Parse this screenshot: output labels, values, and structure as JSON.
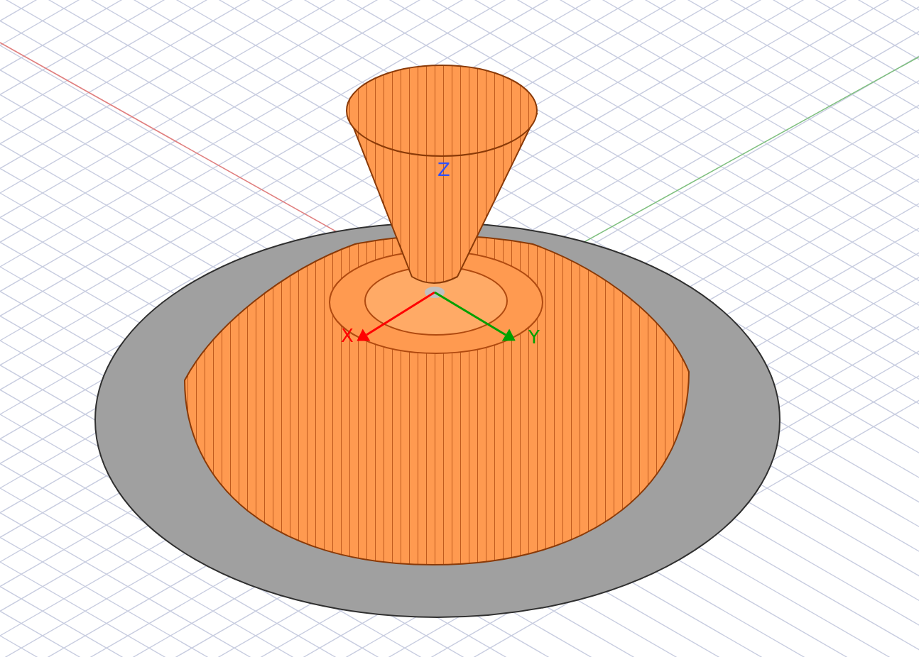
{
  "viewport": {
    "axes": [
      {
        "label": "X",
        "color": "#ff0000"
      },
      {
        "label": "Y",
        "color": "#00a000"
      },
      {
        "label": "Z",
        "color": "#3050ff"
      }
    ]
  }
}
